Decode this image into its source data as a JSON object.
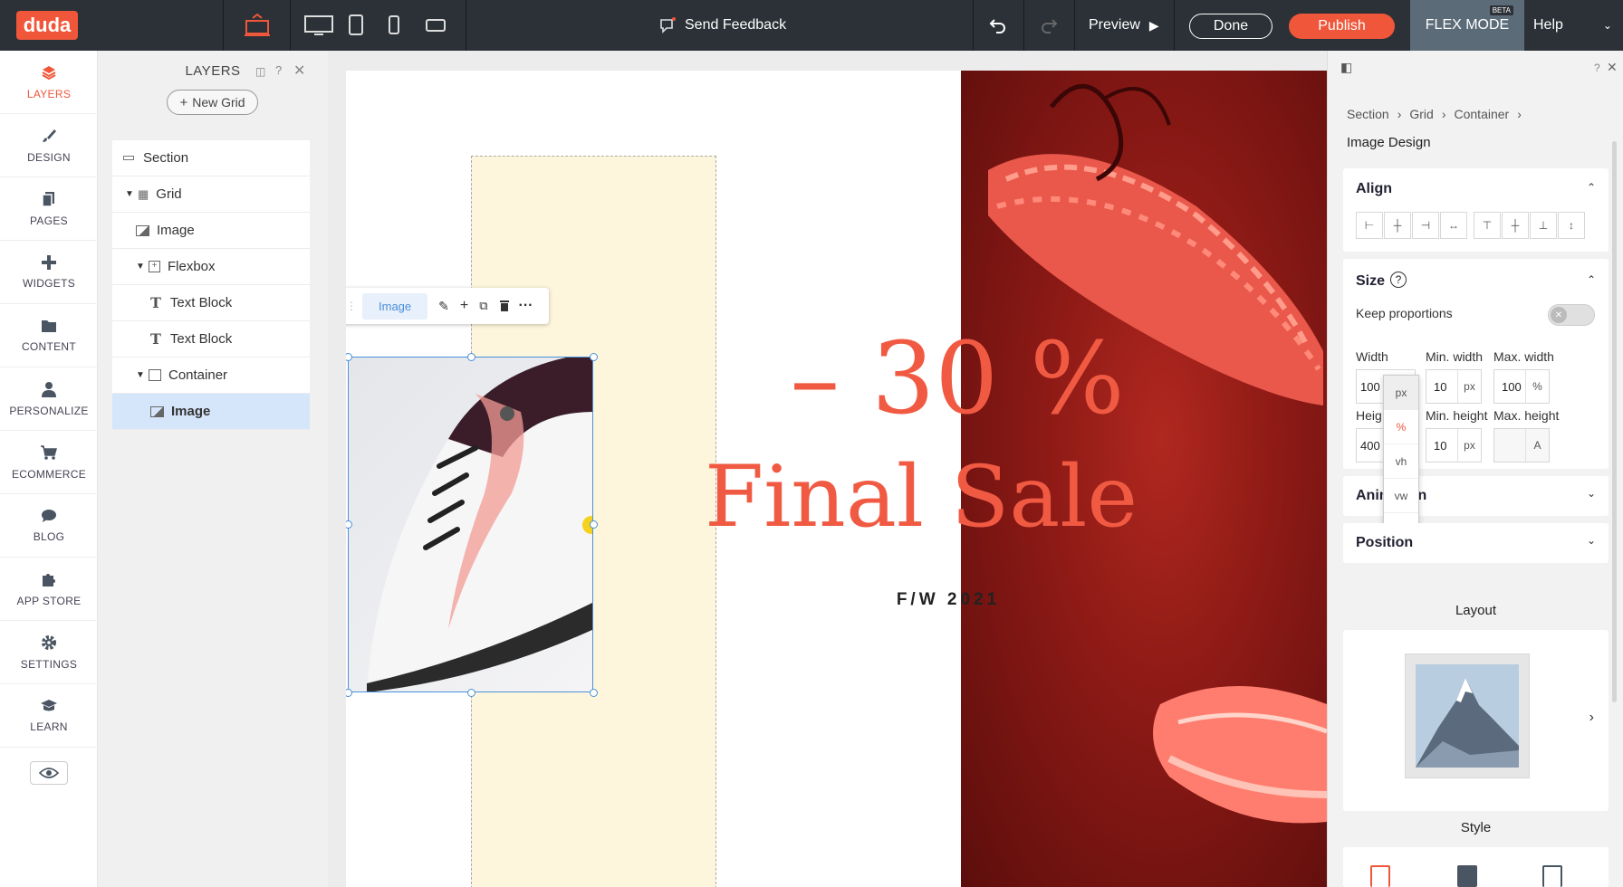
{
  "topbar": {
    "logo": "duda",
    "feedback": "Send Feedback",
    "preview": "Preview",
    "done": "Done",
    "publish": "Publish",
    "flex_mode": "FLEX MODE",
    "beta": "BETA",
    "help": "Help"
  },
  "nav": [
    {
      "label": "LAYERS",
      "icon": "layers-icon"
    },
    {
      "label": "DESIGN",
      "icon": "brush-icon"
    },
    {
      "label": "PAGES",
      "icon": "pages-icon"
    },
    {
      "label": "WIDGETS",
      "icon": "plus-icon"
    },
    {
      "label": "CONTENT",
      "icon": "folder-icon"
    },
    {
      "label": "PERSONALIZE",
      "icon": "person-icon"
    },
    {
      "label": "ECOMMERCE",
      "icon": "cart-icon"
    },
    {
      "label": "BLOG",
      "icon": "chat-icon"
    },
    {
      "label": "APP STORE",
      "icon": "puzzle-icon"
    },
    {
      "label": "SETTINGS",
      "icon": "gear-icon"
    },
    {
      "label": "LEARN",
      "icon": "graduation-cap-icon"
    }
  ],
  "layers": {
    "title": "LAYERS",
    "new_grid": "New Grid",
    "items": [
      {
        "label": "Section",
        "icon": "section-icon"
      },
      {
        "label": "Grid",
        "icon": "grid-icon"
      },
      {
        "label": "Image",
        "icon": "image-icon"
      },
      {
        "label": "Flexbox",
        "icon": "flexbox-icon"
      },
      {
        "label": "Text Block",
        "icon": "text-icon"
      },
      {
        "label": "Text Block",
        "icon": "text-icon"
      },
      {
        "label": "Container",
        "icon": "container-icon"
      },
      {
        "label": "Image",
        "icon": "image-icon"
      }
    ]
  },
  "canvas": {
    "toolbar_label": "Image",
    "discount": "– 30 %",
    "headline": "Final Sale",
    "season": "F/W 2021"
  },
  "panel": {
    "breadcrumb": [
      "Section",
      "Grid",
      "Container"
    ],
    "title": "Image Design",
    "align": "Align",
    "size": "Size",
    "keep_proportions": "Keep proportions",
    "width_label": "Width",
    "width_value": "100",
    "min_width_label": "Min. width",
    "min_width_value": "10",
    "min_width_unit": "px",
    "max_width_label": "Max. width",
    "max_width_value": "100",
    "max_width_unit": "%",
    "height_label": "Heig",
    "height_value": "400",
    "min_height_label": "Min. height",
    "min_height_value": "10",
    "min_height_unit": "px",
    "max_height_label": "Max. height",
    "max_height_unit": "A",
    "unit_options": [
      "px",
      "%",
      "vh",
      "vw",
      "A"
    ],
    "animation": "Animation",
    "position": "Position",
    "layout": "Layout",
    "style": "Style"
  },
  "colors": {
    "accent": "#f0563a",
    "topbar": "#2b3137",
    "selection": "#4a90d9"
  }
}
